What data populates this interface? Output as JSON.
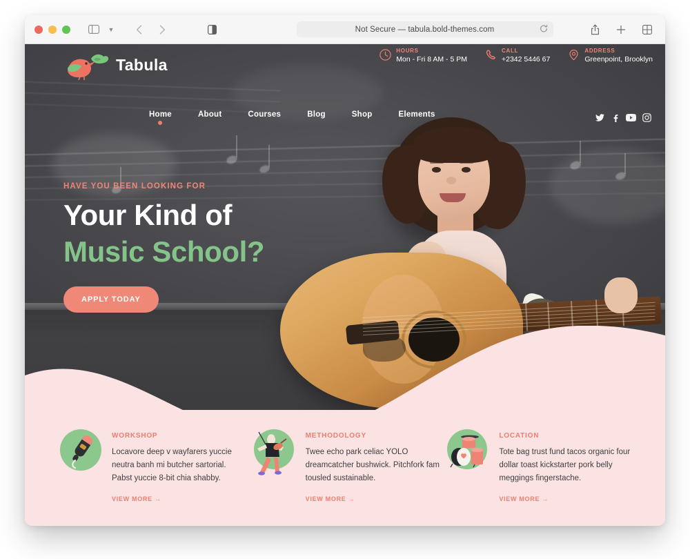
{
  "browser": {
    "address": "Not Secure — tabula.bold-themes.com",
    "icons": {
      "sidebar": "sidebar-icon",
      "sidebar_chevron": "chevron-down-icon",
      "back": "back-arrow-icon",
      "forward": "forward-arrow-icon",
      "reader": "reader-mode-icon",
      "reload": "reload-icon",
      "share": "share-icon",
      "new_tab": "plus-icon",
      "tab_overview": "tab-overview-icon"
    },
    "traffic_lights": [
      "close",
      "minimize",
      "maximize"
    ]
  },
  "site": {
    "logo_text": "Tabula",
    "nav": [
      {
        "label": "Home",
        "active": true
      },
      {
        "label": "About",
        "active": false
      },
      {
        "label": "Courses",
        "active": false
      },
      {
        "label": "Blog",
        "active": false
      },
      {
        "label": "Shop",
        "active": false
      },
      {
        "label": "Elements",
        "active": false
      }
    ],
    "header_info": [
      {
        "icon": "clock-icon",
        "label": "HOURS",
        "value": "Mon - Fri 8 AM - 5 PM"
      },
      {
        "icon": "phone-icon",
        "label": "CALL",
        "value": "+2342 5446 67"
      },
      {
        "icon": "map-pin-icon",
        "label": "ADDRESS",
        "value": "Greenpoint, Brooklyn"
      }
    ],
    "social": [
      "twitter-icon",
      "facebook-icon",
      "youtube-icon",
      "instagram-icon"
    ],
    "hero": {
      "eyebrow": "HAVE YOU BEEN LOOKING FOR",
      "line1": "Your Kind of",
      "line2": "Music School?",
      "cta": "APPLY TODAY"
    },
    "features": [
      {
        "icon": "microphone-icon",
        "title": "WORKSHOP",
        "desc": "Locavore deep v wayfarers yuccie neutra banh mi butcher sartorial. Pabst yuccie 8-bit chia shabby.",
        "link": "VIEW MORE  →"
      },
      {
        "icon": "violinist-icon",
        "title": "METHODOLOGY",
        "desc": "Twee echo park celiac YOLO dreamcatcher bushwick. Pitchfork fam tousled sustainable.",
        "link": "VIEW MORE  →"
      },
      {
        "icon": "drum-kit-icon",
        "title": "LOCATION",
        "desc": "Tote bag trust fund tacos organic four dollar toast kickstarter pork belly meggings fingerstache.",
        "link": "VIEW MORE  →"
      }
    ]
  },
  "colors": {
    "coral": "#ee7f6e",
    "green": "#84c48a",
    "pink_bg": "#fbe3e3",
    "dark_board": "#4a4a4e",
    "white": "#ffffff"
  }
}
